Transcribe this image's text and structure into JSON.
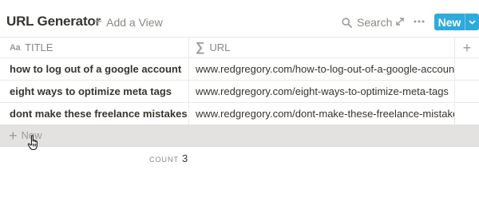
{
  "header": {
    "title": "URL Generator",
    "add_view_label": "Add a View",
    "search_label": "Search",
    "new_button_label": "New"
  },
  "table": {
    "columns": [
      {
        "label": "TITLE",
        "icon": "text-type-icon"
      },
      {
        "label": "URL",
        "icon": "formula-sigma-icon"
      }
    ],
    "rows": [
      {
        "title": "how to log out of a google account",
        "url": "www.redgregory.com/how-to-log-out-of-a-google-account"
      },
      {
        "title": "eight ways to optimize meta tags",
        "url": "www.redgregory.com/eight-ways-to-optimize-meta-tags"
      },
      {
        "title": "dont make these freelance mistakes",
        "url": "www.redgregory.com/dont-make-these-freelance-mistakes"
      }
    ],
    "new_row_label": "New",
    "footer": {
      "count_label": "COUNT",
      "count_value": "3"
    }
  },
  "colors": {
    "accent": "#2eaadc",
    "text": "#37352f",
    "muted": "#9b9a97",
    "border": "#e9e9e7",
    "hover_row": "#e3e2e0"
  },
  "icons": [
    "plus-icon",
    "search-icon",
    "expand-icon",
    "more-icon",
    "chevron-down-icon",
    "hand-cursor-icon"
  ]
}
